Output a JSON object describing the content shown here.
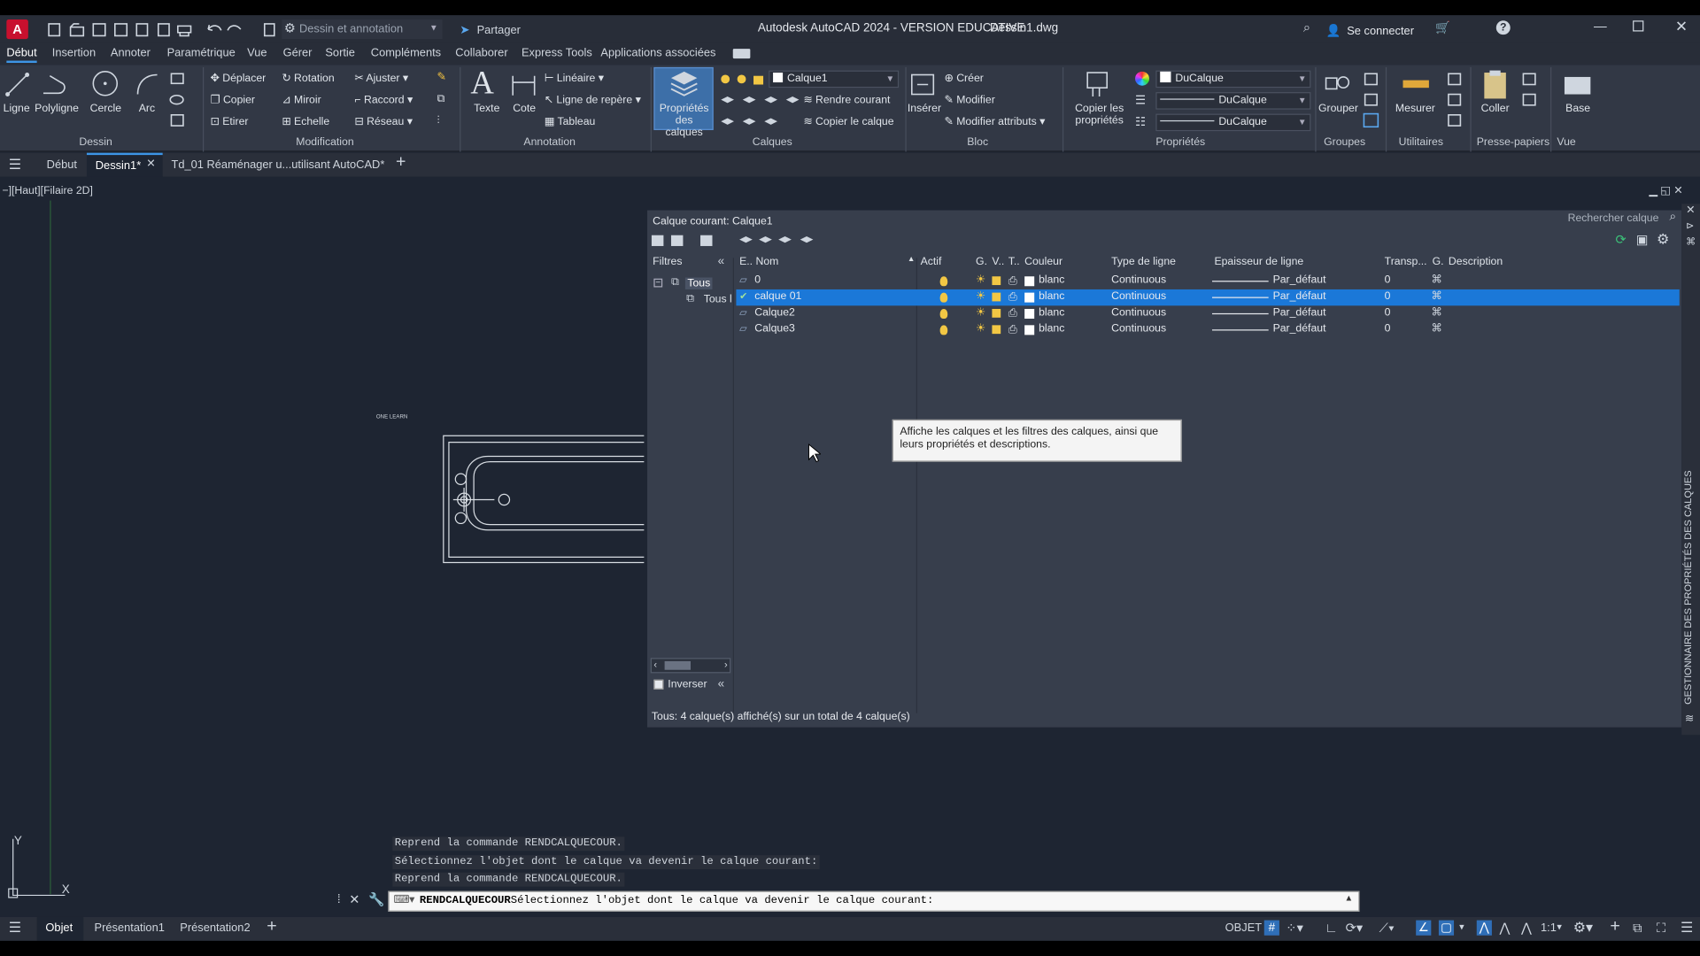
{
  "titlebar": {
    "workspace": "Dessin et annotation",
    "share": "Partager",
    "title": "Autodesk AutoCAD 2024 - VERSION EDUCATIVE",
    "filename": "Dessin1.dwg",
    "signin": "Se connecter"
  },
  "menu": [
    "Début",
    "Insertion",
    "Annoter",
    "Paramétrique",
    "Vue",
    "Gérer",
    "Sortie",
    "Compléments",
    "Collaborer",
    "Express Tools",
    "Applications associées"
  ],
  "ribbon": {
    "draw": {
      "ligne": "Ligne",
      "polyligne": "Polyligne",
      "cercle": "Cercle",
      "arc": "Arc",
      "panel": "Dessin"
    },
    "modify": {
      "deplacer": "Déplacer",
      "rotation": "Rotation",
      "ajuster": "Ajuster",
      "copier": "Copier",
      "miroir": "Miroir",
      "raccord": "Raccord",
      "etirer": "Etirer",
      "echelle": "Echelle",
      "reseau": "Réseau",
      "panel": "Modification"
    },
    "annotation": {
      "texte": "Texte",
      "cote": "Cote",
      "lineaire": "Linéaire",
      "ligne_repere": "Ligne de repère",
      "tableau": "Tableau",
      "panel": "Annotation"
    },
    "layers": {
      "proprietes": "Propriétés des calques",
      "combo": "Calque1",
      "rendre_courant": "Rendre courant",
      "copier_calque": "Copier le calque",
      "panel": "Calques"
    },
    "block": {
      "inserer": "Insérer",
      "creer": "Créer",
      "modifier": "Modifier",
      "modifier_attributs": "Modifier attributs",
      "panel": "Bloc"
    },
    "properties": {
      "copier_proprietes": "Copier les propriétés",
      "color": "DuCalque",
      "linetype": "DuCalque",
      "lineweight": "DuCalque",
      "panel": "Propriétés"
    },
    "groups": {
      "grouper": "Grouper",
      "panel": "Groupes"
    },
    "utilities": {
      "mesurer": "Mesurer",
      "panel": "Utilitaires"
    },
    "clipboard": {
      "coller": "Coller",
      "panel": "Presse-papiers"
    },
    "view": {
      "base": "Base",
      "panel": "Vue"
    }
  },
  "doctabs": {
    "start": "Début",
    "current": "Dessin1*",
    "other": "Td_01 Réaménager u...utilisant AutoCAD*"
  },
  "viewport_label": "−][Haut][Filaire 2D]",
  "drawing_label": "ONE LEARN",
  "layer_manager": {
    "current_layer": "Calque courant: Calque1",
    "search_placeholder": "Rechercher calque",
    "filters_label": "Filtres",
    "tree_all": "Tous",
    "tree_used": "Tous l",
    "invert_label": "Inverser",
    "status": "Tous: 4 calque(s) affiché(s) sur un total de 4 calque(s)",
    "side_title": "GESTIONNAIRE DES PROPRIÉTÉS DES CALQUES",
    "tooltip": "Affiche les calques et les filtres des calques, ainsi que leurs propriétés et descriptions.",
    "columns": {
      "etat": "E..",
      "nom": "Nom",
      "actif": "Actif",
      "gele": "G.",
      "verrou": "V..",
      "tracer": "T..",
      "couleur": "Couleur",
      "type": "Type de ligne",
      "epaisseur": "Epaisseur de ligne",
      "transp": "Transp...",
      "g": "G.",
      "description": "Description"
    },
    "rows": [
      {
        "name": "0",
        "color": "blanc",
        "linetype": "Continuous",
        "lineweight": "Par_défaut",
        "transparency": "0",
        "selected": false
      },
      {
        "name": "calque 01",
        "color": "blanc",
        "linetype": "Continuous",
        "lineweight": "Par_défaut",
        "transparency": "0",
        "selected": true
      },
      {
        "name": "Calque2",
        "color": "blanc",
        "linetype": "Continuous",
        "lineweight": "Par_défaut",
        "transparency": "0",
        "selected": false
      },
      {
        "name": "Calque3",
        "color": "blanc",
        "linetype": "Continuous",
        "lineweight": "Par_défaut",
        "transparency": "0",
        "selected": false
      }
    ]
  },
  "command": {
    "history": [
      "Reprend la commande RENDCALQUECOUR.",
      "Sélectionnez l'objet dont le calque va devenir le calque courant:",
      "Reprend la commande RENDCALQUECOUR."
    ],
    "current_cmd": "RENDCALQUECOUR",
    "current_prompt": "Sélectionnez l'objet dont le calque va devenir le calque courant:"
  },
  "statusbar": {
    "objet": "Objet",
    "presentation1": "Présentation1",
    "presentation2": "Présentation2",
    "mode": "OBJET",
    "scale": "1:1"
  },
  "colors": {
    "accent": "#3d95e6",
    "selected_row": "#1b78d8",
    "panel": "#373e4c",
    "canvas": "#1e2532"
  }
}
